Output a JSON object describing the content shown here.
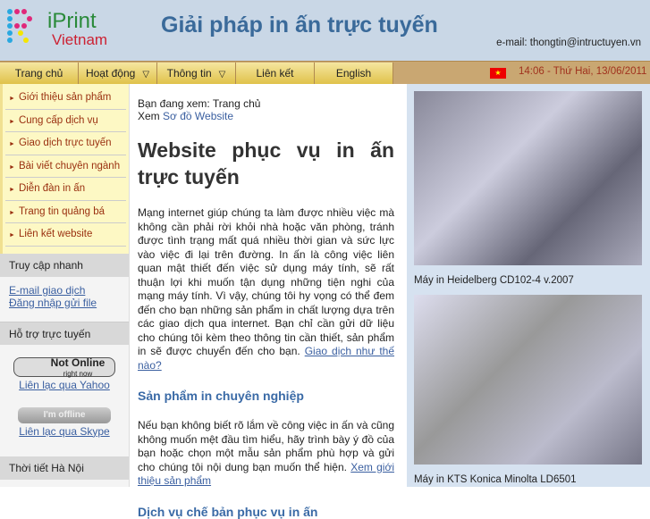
{
  "header": {
    "logo_top": "iPrint",
    "logo_bottom": "Vietnam",
    "title": "Giải pháp in ấn trực tuyến",
    "email": "e-mail: thongtin@intructuyen.vn"
  },
  "nav": {
    "items": [
      {
        "label": "Trang chủ"
      },
      {
        "label": "Hoạt động",
        "dropdown": true
      },
      {
        "label": "Thông tin",
        "dropdown": true
      },
      {
        "label": "Liên kết"
      },
      {
        "label": "English"
      }
    ],
    "datetime": "14:06 - Thứ Hai, 13/06/2011",
    "flag_icon": "★"
  },
  "sidebar": {
    "menu": [
      "Giới thiệu sản phẩm",
      "Cung cấp dịch vụ",
      "Giao dịch trực tuyến",
      "Bài viết chuyên ngành",
      "Diễn đàn in ấn",
      "Trang tin quảng bá",
      "Liên kết website"
    ],
    "quick": {
      "title": "Truy cập nhanh",
      "links": [
        "E-mail giao dịch",
        "Đăng nhập gửi file"
      ]
    },
    "support": {
      "title": "Hỗ trợ trực tuyến",
      "yahoo_badge": "Not Online",
      "yahoo_badge_sub": "right now",
      "yahoo_link": "Liên lạc qua Yahoo",
      "skype_badge": "I'm offline",
      "skype_link": "Liên lạc qua Skype"
    },
    "weather": {
      "title": "Thời tiết Hà Nội"
    }
  },
  "main": {
    "breadcrumb": "Bạn đang xem: Trang chủ",
    "sitemap_prefix": "Xem",
    "sitemap_link": "Sơ đồ Website",
    "title": "Website phục vụ in ấn trực tuyến",
    "intro": "Mạng internet giúp chúng ta làm được nhiều việc mà không cần phải rời khỏi nhà hoặc văn phòng, tránh được tình trạng mất quá nhiều thời gian và sức lực vào việc đi lại trên đường. In ấn là công việc liên quan mật thiết đến việc sử dụng máy tính, sẽ rất thuận lợi khi muốn tận dụng những tiện nghi của mạng máy tính. Vì vậy, chúng tôi hy vọng có thể đem đến cho bạn những sản phẩm in chất lượng dựa trên các giao dịch qua internet. Bạn chỉ cần gửi dữ liệu cho chúng tôi kèm theo thông tin cần thiết, sản phẩm in sẽ được chuyển đến cho bạn.",
    "intro_link": "Giao dịch như thế nào?",
    "h2_1": "Sản phẩm in chuyên nghiệp",
    "p2": "Nếu bạn không biết rõ lắm về công việc in ấn và cũng không muốn mệt đầu tìm hiểu, hãy trình bày ý đồ của bạn hoặc chọn một mẫu sản phẩm phù hợp và gửi cho chúng tôi nội dung bạn muốn thể hiện.",
    "p2_link": "Xem giới thiệu sản phẩm",
    "h2_2": "Dịch vụ chế bản phục vụ in ấn"
  },
  "right": {
    "captions": [
      "Máy in Heidelberg CD102-4 v.2007",
      "Máy in KTS Konica Minolta LD6501"
    ]
  }
}
